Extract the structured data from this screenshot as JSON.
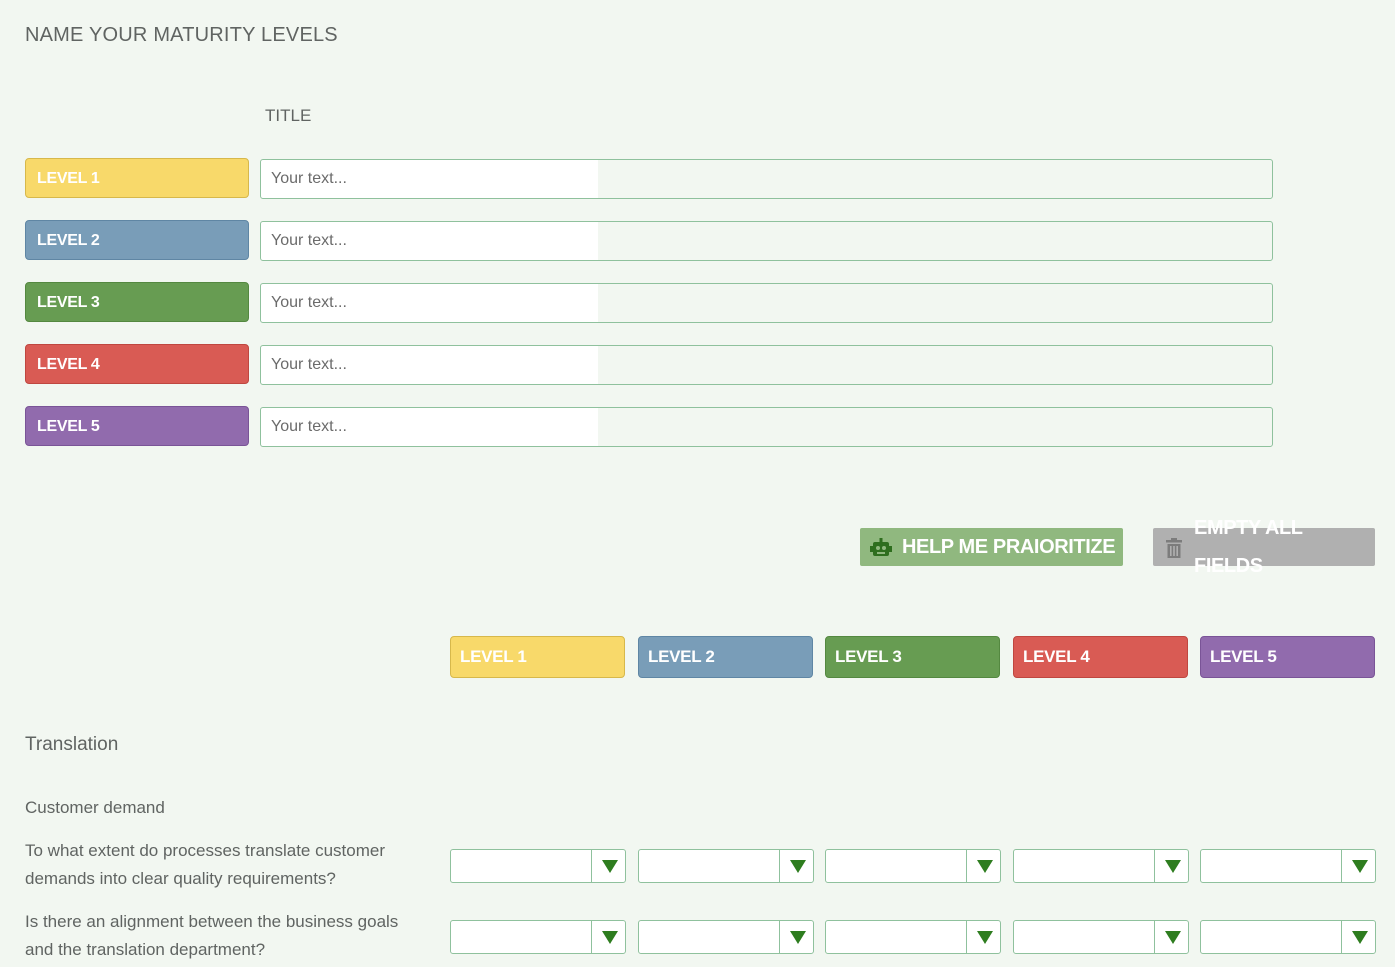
{
  "header": {
    "title": "NAME YOUR MATURITY LEVELS",
    "column_title": "TITLE"
  },
  "levels": [
    {
      "label": "LEVEL 1",
      "placeholder": "Your text...",
      "color": "#f8d96a"
    },
    {
      "label": "LEVEL 2",
      "placeholder": "Your text...",
      "color": "#799db8"
    },
    {
      "label": "LEVEL 3",
      "placeholder": "Your text...",
      "color": "#679c52"
    },
    {
      "label": "LEVEL 4",
      "placeholder": "Your text...",
      "color": "#d95b54"
    },
    {
      "label": "LEVEL 5",
      "placeholder": "Your text...",
      "color": "#916bad"
    }
  ],
  "actions": {
    "help_label": "HELP ME PRAIORITIZE",
    "help_icon": "robot-icon",
    "empty_label": "EMPTY ALL FIELDS",
    "empty_icon": "trash-icon"
  },
  "matrix": {
    "columns": [
      "LEVEL 1",
      "LEVEL 2",
      "LEVEL 3",
      "LEVEL 4",
      "LEVEL 5"
    ],
    "section": "Translation",
    "subsection": "Customer demand",
    "questions": [
      {
        "text": "To what extent do processes translate customer demands into clear quality requirements?",
        "values": [
          "",
          "",
          "",
          "",
          ""
        ]
      },
      {
        "text": "Is there an alignment between the business goals and the translation department?",
        "values": [
          "",
          "",
          "",
          "",
          ""
        ]
      }
    ]
  },
  "colors": {
    "accent_green": "#2e7d1f",
    "field_border": "#8fc19d",
    "background": "#f2f7f1"
  }
}
